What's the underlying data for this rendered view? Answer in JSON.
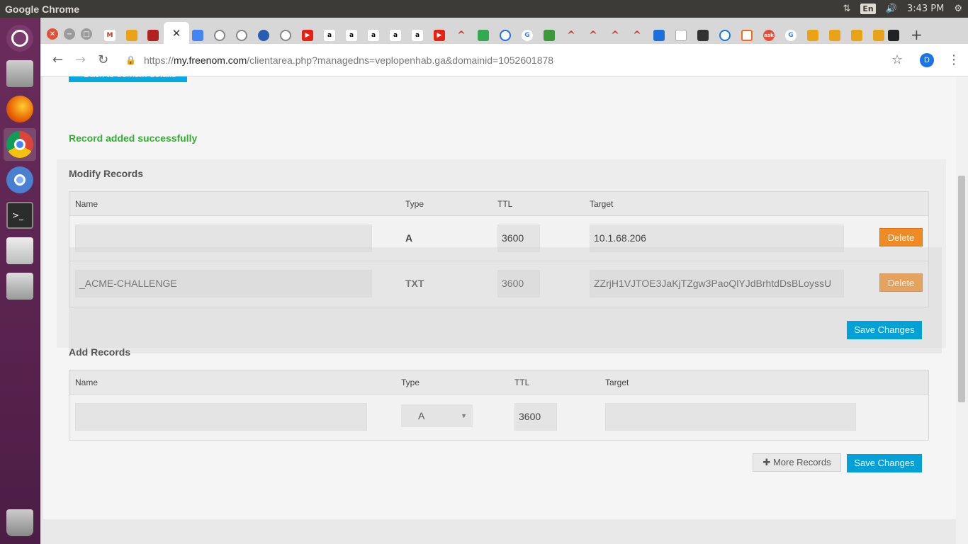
{
  "system": {
    "app_title": "Google Chrome",
    "lang": "En",
    "clock": "3:43 PM"
  },
  "browser": {
    "url_scheme": "https://",
    "url_host": "my.freenom.com",
    "url_path": "/clientarea.php?managedns=veplopenhab.ga&domainid=1052601878",
    "profile_initial": "D"
  },
  "page": {
    "back_button": "« Back to domain details",
    "success_message": "Record added successfully",
    "modify": {
      "title": "Modify Records",
      "columns": [
        "Name",
        "Type",
        "TTL",
        "Target"
      ],
      "rows": [
        {
          "name": "",
          "type": "A",
          "ttl": "3600",
          "target": "10.1.68.206",
          "delete": "Delete"
        },
        {
          "name": "_ACME-CHALLENGE",
          "type": "TXT",
          "ttl": "3600",
          "target": "ZZrjH1VJTOE3JaKjTZgw3PaoQlYJdBrhtdDsBLoyssU",
          "delete": "Delete"
        }
      ],
      "save": "Save Changes"
    },
    "add": {
      "title": "Add Records",
      "columns": [
        "Name",
        "Type",
        "TTL",
        "Target"
      ],
      "row": {
        "name": "",
        "type": "A",
        "ttl": "3600",
        "target": ""
      },
      "more": "More Records",
      "save": "Save Changes"
    }
  },
  "colors": {
    "accent_blue": "#04a0d8",
    "delete_orange": "#f08a24",
    "success_green": "#2fb32f",
    "launcher": "#5e2750"
  }
}
